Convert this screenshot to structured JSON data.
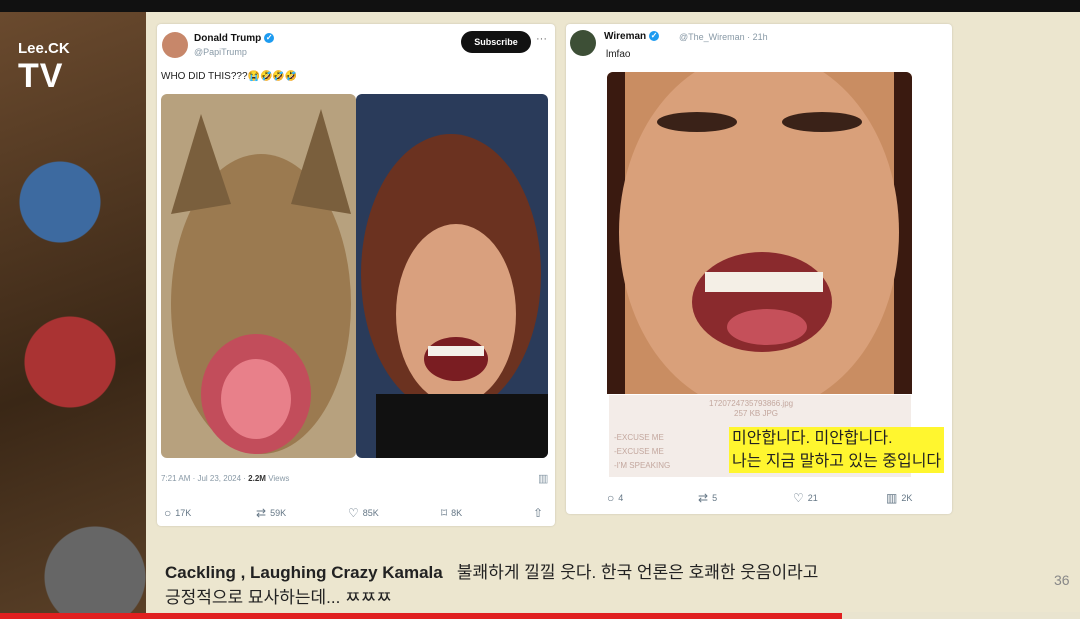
{
  "channel_logo": {
    "top": "Lee.CK",
    "bottom": "TV"
  },
  "tweet1": {
    "name": "Donald Trump",
    "handle": "@PapiTrump",
    "subscribe_label": "Subscribe",
    "more": "···",
    "text": "WHO DID THIS???😭🤣🤣🤣",
    "meta_time": "7:21 AM · Jul 23, 2024 · ",
    "meta_views": "2.2M",
    "meta_views_label": " Views",
    "actions": [
      "17K",
      "59K",
      "85K",
      "8K"
    ]
  },
  "tweet2": {
    "name": "Wireman",
    "handle": "@The_Wireman · 21h",
    "text": "lmfao",
    "attachment_filename": "1720724735793866.jpg",
    "attachment_size": "257 KB JPG",
    "attachment_lines": [
      "-EXCUSE ME",
      "-EXCUSE ME",
      "-I'M SPEAKING"
    ],
    "actions": [
      "4",
      "5",
      "21",
      "2K"
    ]
  },
  "subtitle": {
    "line1": "미안합니다. 미안합니다.",
    "line2": "나는 지금 말하고 있는 중입니다"
  },
  "caption": {
    "english": "Cackling , Laughing  Crazy Kamala",
    "korean_line1": "불쾌하게 낄낄 웃다.  한국 언론은 호쾌한 웃음이라고",
    "korean_line2": "긍정적으로 묘사하는데... ㅉㅉㅉ"
  },
  "page_number": "36",
  "video_progress": 0.78,
  "colors": {
    "accent_progress": "#e02020",
    "subtitle_bg": "#fff62f",
    "verified": "#1d9bf0"
  }
}
